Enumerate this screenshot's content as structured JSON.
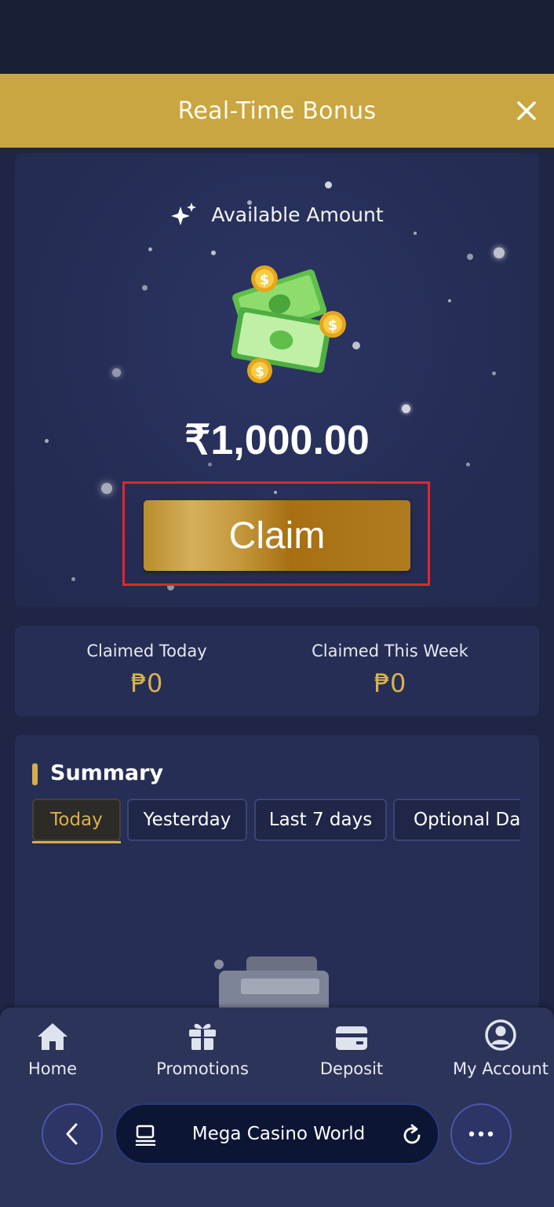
{
  "header": {
    "title": "Real-Time Bonus"
  },
  "bonus": {
    "available_label": "Available Amount",
    "amount": "₹1,000.00",
    "claim_label": "Claim"
  },
  "stats": [
    {
      "label": "Claimed Today",
      "value": "₱0"
    },
    {
      "label": "Claimed This Week",
      "value": "₱0"
    }
  ],
  "summary": {
    "title": "Summary",
    "tabs": [
      "Today",
      "Yesterday",
      "Last 7 days",
      "Optional Dat"
    ],
    "active_tab": "Today"
  },
  "nav": {
    "items": [
      {
        "label": "Home",
        "icon": "home-icon"
      },
      {
        "label": "Promotions",
        "icon": "gift-icon"
      },
      {
        "label": "Deposit",
        "icon": "card-icon"
      },
      {
        "label": "My Account",
        "icon": "user-icon"
      }
    ]
  },
  "browser": {
    "site_name": "Mega Casino World"
  },
  "colors": {
    "gold": "#c9a640",
    "background": "#1a1f38",
    "card": "#262e55",
    "highlight_outline": "#e2262e"
  }
}
